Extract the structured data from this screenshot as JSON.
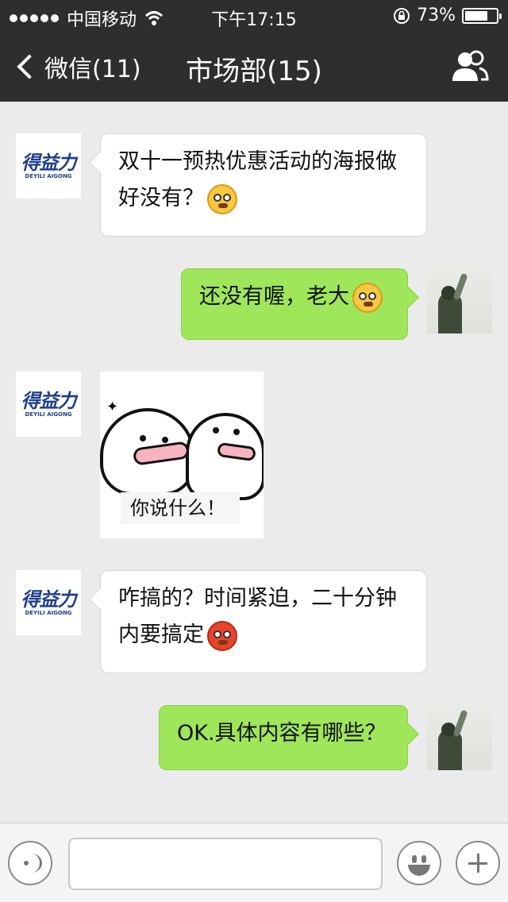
{
  "status_bar": {
    "carrier": "中国移动",
    "time": "下午17:15",
    "battery": "73%",
    "battery_level": 0.73
  },
  "nav": {
    "back_label": "微信(11)",
    "title": "市场部(15)",
    "people_icon": "group-icon"
  },
  "messages": [
    {
      "side": "in",
      "sender_avatar": "logo",
      "avatar_text": "得益力",
      "avatar_sub": "DEYILI AIGONG",
      "text": "双十一预热优惠活动的海报做好没有？",
      "emoji": "dizzy-face"
    },
    {
      "side": "out",
      "sender_avatar": "photo",
      "text": "还没有喔，老大",
      "emoji": "angry-face"
    },
    {
      "side": "in",
      "sender_avatar": "logo",
      "avatar_text": "得益力",
      "avatar_sub": "DEYILI AIGONG",
      "sticker_caption": "你说什么！"
    },
    {
      "side": "in",
      "sender_avatar": "logo",
      "avatar_text": "得益力",
      "avatar_sub": "DEYILI AIGONG",
      "text": "咋搞的？时间紧迫，二十分钟内要搞定",
      "emoji": "furious-face"
    },
    {
      "side": "out",
      "sender_avatar": "photo",
      "text": "OK.具体内容有哪些？"
    }
  ],
  "input_bar": {
    "placeholder": "",
    "voice_icon": "voice-icon",
    "emoji_icon": "emoji-icon",
    "plus_icon": "plus-icon"
  }
}
